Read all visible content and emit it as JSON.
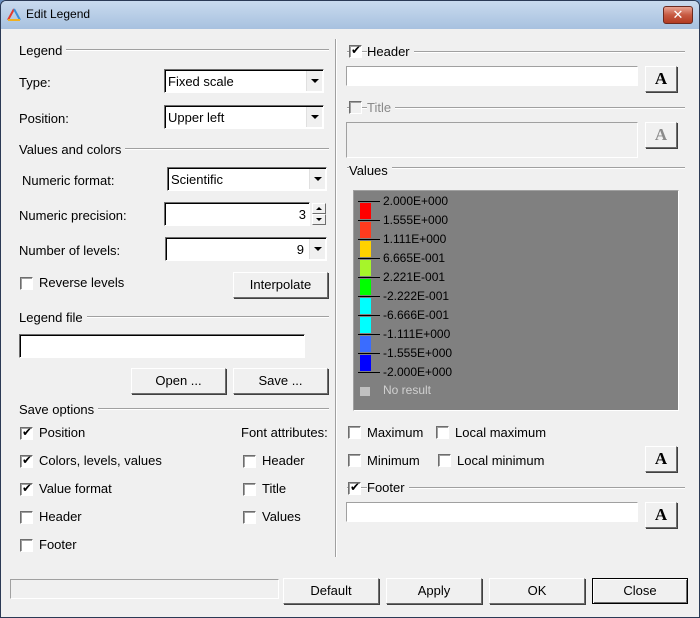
{
  "window": {
    "title": "Edit Legend",
    "close_glyph": "✕"
  },
  "legend_group": {
    "label": "Legend",
    "type_label": "Type:",
    "type_value": "Fixed scale",
    "position_label": "Position:",
    "position_value": "Upper left"
  },
  "values_colors_group": {
    "label": "Values and colors",
    "numeric_format_label": "Numeric format:",
    "numeric_format_value": "Scientific",
    "numeric_precision_label": "Numeric precision:",
    "numeric_precision_value": "3",
    "number_of_levels_label": "Number of levels:",
    "number_of_levels_value": "9",
    "reverse_levels_label": "Reverse levels",
    "reverse_levels_checked": false,
    "interpolate_label": "Interpolate"
  },
  "legend_file_group": {
    "label": "Legend file",
    "path_value": "",
    "open_label": "Open ...",
    "save_label": "Save ..."
  },
  "save_options_group": {
    "label": "Save options",
    "options": [
      {
        "label": "Position",
        "checked": true
      },
      {
        "label": "Colors, levels, values",
        "checked": true
      },
      {
        "label": "Value format",
        "checked": true
      },
      {
        "label": "Header",
        "checked": false
      },
      {
        "label": "Footer",
        "checked": false
      }
    ],
    "font_attributes_label": "Font attributes:",
    "font_attributes": [
      {
        "label": "Header",
        "checked": false
      },
      {
        "label": "Title",
        "checked": false
      },
      {
        "label": "Values",
        "checked": false
      }
    ]
  },
  "header_group": {
    "label": "Header",
    "checked": true,
    "value": "",
    "font_button_glyph": "A"
  },
  "title_group": {
    "label": "Title",
    "checked": false,
    "enabled": false,
    "value": "",
    "font_button_glyph": "A"
  },
  "values_group": {
    "label": "Values",
    "levels": [
      "2.000E+000",
      "1.555E+000",
      "1.111E+000",
      "6.665E-001",
      "2.221E-001",
      "-2.222E-001",
      "-6.666E-001",
      "-1.111E+000",
      "-1.555E+000",
      "-2.000E+000"
    ],
    "colors": [
      "#ff0000",
      "#ff3b1e",
      "#ffd200",
      "#a6f52a",
      "#00ff00",
      "#00ffff",
      "#00ffff",
      "#3a6cff",
      "#0000ff"
    ],
    "no_result_label": "No result",
    "no_result_color": "#c0c0c0",
    "panel_color": "#808080",
    "maximum_label": "Maximum",
    "maximum_checked": false,
    "local_maximum_label": "Local maximum",
    "local_maximum_checked": false,
    "minimum_label": "Minimum",
    "minimum_checked": false,
    "local_minimum_label": "Local minimum",
    "local_minimum_checked": false,
    "font_button_glyph": "A"
  },
  "footer_group": {
    "label": "Footer",
    "checked": true,
    "value": "",
    "font_button_glyph": "A"
  },
  "bottom_bar": {
    "status_text": "",
    "default_label": "Default",
    "apply_label": "Apply",
    "ok_label": "OK",
    "close_label": "Close"
  }
}
